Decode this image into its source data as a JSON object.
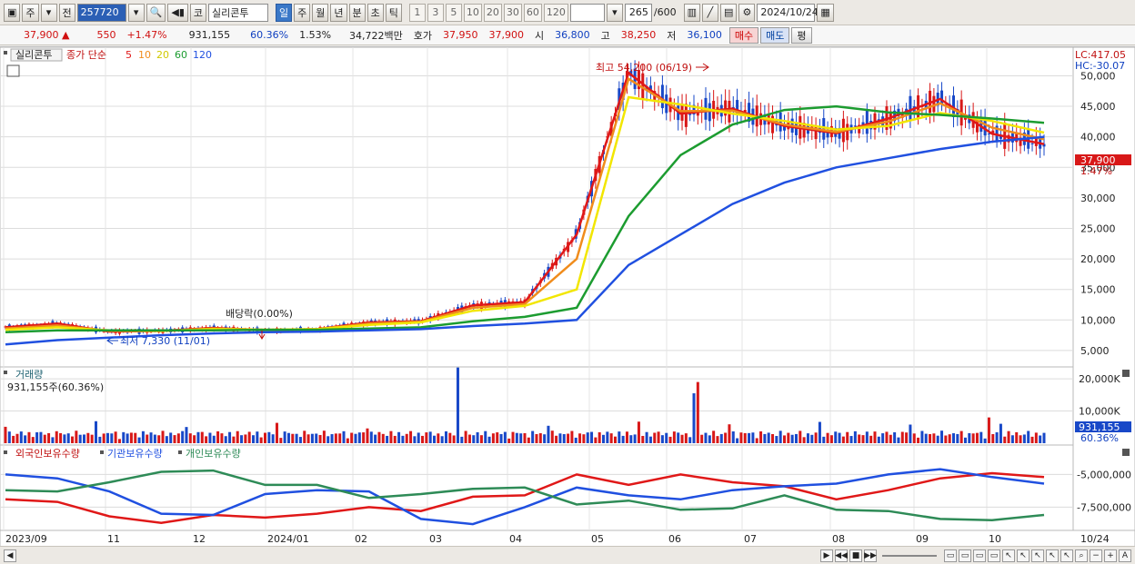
{
  "toolbar": {
    "mode_main": "주",
    "mode_prev": "전",
    "code": "257720",
    "market_tag": "코",
    "stock_name": "실리콘투",
    "periods": [
      "일",
      "주",
      "월",
      "년",
      "분",
      "초",
      "틱"
    ],
    "active_period": "일",
    "interval_values": [
      "1",
      "3",
      "5",
      "10",
      "20",
      "30",
      "60",
      "120"
    ],
    "count": "265",
    "max_count": "/600",
    "date": "2024/10/24"
  },
  "quote": {
    "price": "37,900",
    "arrow": "▲",
    "change": "550",
    "change_pct": "+1.47%",
    "volume": "931,155",
    "volume_ratio": "60.36%",
    "turnover": "1.53%",
    "amount": "34,722백만",
    "ask_label": "호가",
    "ask": "37,950",
    "bid": "37,900",
    "open_label": "시",
    "open": "36,800",
    "high_label": "고",
    "high": "38,250",
    "low_label": "저",
    "low": "36,100",
    "buy_label": "매수",
    "sell_label": "매도",
    "eval_label": "평"
  },
  "price_panel": {
    "stock_tab": "실리콘투",
    "legend_prefix": "종가 단순",
    "ma_legend": [
      {
        "label": "5",
        "color": "#e01818"
      },
      {
        "label": "10",
        "color": "#f08c1c"
      },
      {
        "label": "20",
        "color": "#e8e000"
      },
      {
        "label": "60",
        "color": "#1c9c30"
      },
      {
        "label": "120",
        "color": "#2050e0"
      }
    ],
    "lc": "LC:417.05",
    "hc": "HC:-30.07",
    "current_price_label": "37,900",
    "current_change_label": "1.47%",
    "high_annotation": "최고 54,200 (06/19)",
    "low_annotation": "최저 7,330 (11/01)",
    "dividend_annotation": "배당락(0.00%)",
    "y_ticks": [
      "50,000",
      "45,000",
      "40,000",
      "35,000",
      "30,000",
      "25,000",
      "20,000",
      "15,000",
      "10,000",
      "5,000"
    ]
  },
  "volume_panel": {
    "title": "거래량",
    "value_label": "931,155주(60.36%)",
    "y_ticks": [
      "20,000K",
      "10,000K"
    ],
    "current_value": "931,155",
    "current_pct": "60.36%"
  },
  "holding_panel": {
    "legend": [
      {
        "label": "외국인보유수량",
        "color": "#e01818"
      },
      {
        "label": "기관보유수량",
        "color": "#2050e0"
      },
      {
        "label": "개인보유수량",
        "color": "#2e8b57"
      }
    ],
    "y_ticks": [
      "-5,000,000",
      "-7,500,000"
    ]
  },
  "x_axis": {
    "labels": [
      "2023/09",
      "11",
      "12",
      "2024/01",
      "02",
      "03",
      "04",
      "05",
      "06",
      "07",
      "08",
      "09",
      "10",
      "10/24"
    ]
  },
  "chart_data": [
    {
      "type": "line",
      "title": "",
      "series": [
        {
          "name": "5",
          "values": [
            8800,
            9400,
            8100,
            8200,
            8700,
            8300,
            8500,
            9600,
            9800,
            12400,
            12900,
            24000,
            50500,
            43800,
            44600,
            41800,
            40600,
            43000,
            46200,
            40500,
            38800
          ]
        },
        {
          "name": "10",
          "values": [
            8600,
            9100,
            8200,
            8200,
            8600,
            8400,
            8500,
            9400,
            9700,
            12000,
            12600,
            20000,
            49500,
            44200,
            44300,
            42000,
            40800,
            42500,
            45500,
            41500,
            39600
          ]
        },
        {
          "name": "20",
          "values": [
            8400,
            8800,
            8300,
            8200,
            8500,
            8400,
            8500,
            9200,
            9600,
            11500,
            12300,
            15000,
            46500,
            45300,
            43800,
            42600,
            41200,
            41800,
            43900,
            42600,
            40700
          ]
        },
        {
          "name": "60",
          "values": [
            8000,
            8300,
            8300,
            8300,
            8300,
            8400,
            8400,
            8600,
            8800,
            9800,
            10500,
            12000,
            27000,
            37000,
            42000,
            44400,
            45000,
            44000,
            43600,
            43000,
            42300
          ]
        },
        {
          "name": "120",
          "values": [
            6000,
            6700,
            7100,
            7500,
            7800,
            8000,
            8100,
            8300,
            8500,
            9000,
            9400,
            10000,
            19000,
            24000,
            29000,
            32500,
            35000,
            36500,
            38000,
            39200,
            40000
          ]
        }
      ],
      "ylim": [
        5000,
        50000
      ],
      "annotations": [
        "최고 54,200 (06/19)",
        "최저 7,330 (11/01)",
        "배당락(0.00%)"
      ]
    },
    {
      "type": "line",
      "title": "",
      "series": [
        {
          "name": "외국인보유수량",
          "values": [
            -6900000,
            -7100000,
            -8200000,
            -8700000,
            -8100000,
            -8300000,
            -8000000,
            -7500000,
            -7800000,
            -6700000,
            -6600000,
            -5000000,
            -5800000,
            -5000000,
            -5600000,
            -5900000,
            -6900000,
            -6200000,
            -5300000,
            -4900000,
            -5200000
          ]
        },
        {
          "name": "기관보유수량",
          "values": [
            -5000000,
            -5300000,
            -6300000,
            -8000000,
            -8100000,
            -6500000,
            -6200000,
            -6300000,
            -8400000,
            -8800000,
            -7500000,
            -6000000,
            -6600000,
            -6900000,
            -6200000,
            -5900000,
            -5700000,
            -5000000,
            -4600000,
            -5200000,
            -5700000
          ]
        },
        {
          "name": "개인보유수량",
          "values": [
            -6200000,
            -6300000,
            -5600000,
            -4800000,
            -4700000,
            -5800000,
            -5800000,
            -6800000,
            -6500000,
            -6100000,
            -6000000,
            -7300000,
            -7000000,
            -7700000,
            -7600000,
            -6600000,
            -7700000,
            -7800000,
            -8400000,
            -8500000,
            -8100000
          ]
        }
      ],
      "ylim": [
        -9000000,
        -4000000
      ]
    }
  ],
  "colors": {
    "up": "#d01010",
    "down": "#1040c0",
    "grid": "#d8d8d8"
  }
}
